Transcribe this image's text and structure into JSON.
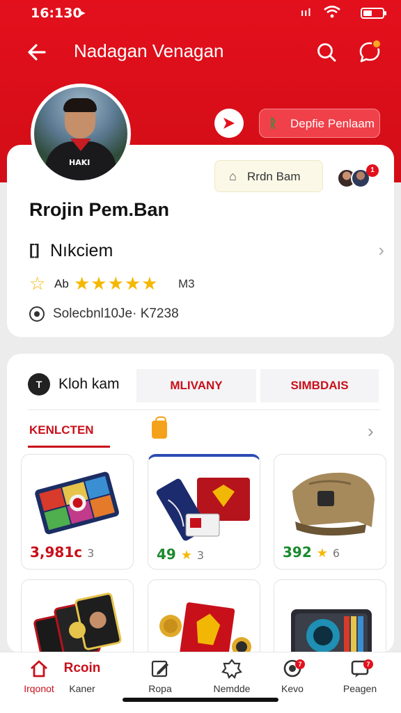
{
  "status_bar": {
    "time": "16:130",
    "signal": "ııl"
  },
  "header": {
    "title": "Nadagan Venagan"
  },
  "profile": {
    "jersey_text": "HAKI",
    "profile_button_label": "Depfie Penlaam",
    "outline_button_label": "Rrdn Bam",
    "friends_badge": "1",
    "name": "Rrojin Pem.Ban",
    "nickname": "Nıkciem",
    "nickname_icon": "[]",
    "rating_label": "Ab",
    "rating_stars": "★★★★★",
    "rating_count": "M3",
    "id_text": "Solecbnl10Je· K7238"
  },
  "section": {
    "icon_text": "T",
    "label": "Kloh kam",
    "tabs": [
      "MLIVANY",
      "SIMBDAIS"
    ],
    "sub_tab": "KENLCTEN"
  },
  "items": [
    {
      "price": "3,981c",
      "extra": "3",
      "star": "",
      "color": "red"
    },
    {
      "price": "49",
      "extra": "3",
      "star": "★",
      "color": "green"
    },
    {
      "price": "392",
      "extra": "6",
      "star": "★",
      "color": "green"
    },
    {
      "price": "",
      "extra": "",
      "star": "",
      "color": "red"
    },
    {
      "price": "",
      "extra": "",
      "star": "",
      "color": "red"
    },
    {
      "price": "",
      "extra": "",
      "star": "",
      "color": "red"
    }
  ],
  "bottom_nav": {
    "items": [
      {
        "label": "Irqonot",
        "extra": "Rcoin"
      },
      {
        "label": "Kaner"
      },
      {
        "label": "Ropa"
      },
      {
        "label": "Nemdde"
      },
      {
        "label": "Kevo",
        "badge": "7"
      },
      {
        "label": "Peagen",
        "badge": "7"
      }
    ]
  },
  "colors": {
    "brand_red": "#e3101c",
    "accent_red": "#c8101b",
    "star": "#f5b800",
    "price_green": "#1c8a2e"
  },
  "icons": [
    "back-arrow-icon",
    "search-icon",
    "chat-icon",
    "play-icon",
    "leaf-icon",
    "house-icon",
    "note-icon",
    "star-icon",
    "target-icon",
    "bag-icon",
    "chevron-right-icon",
    "home-icon",
    "edit-icon",
    "badge-icon",
    "record-icon",
    "message-icon"
  ]
}
